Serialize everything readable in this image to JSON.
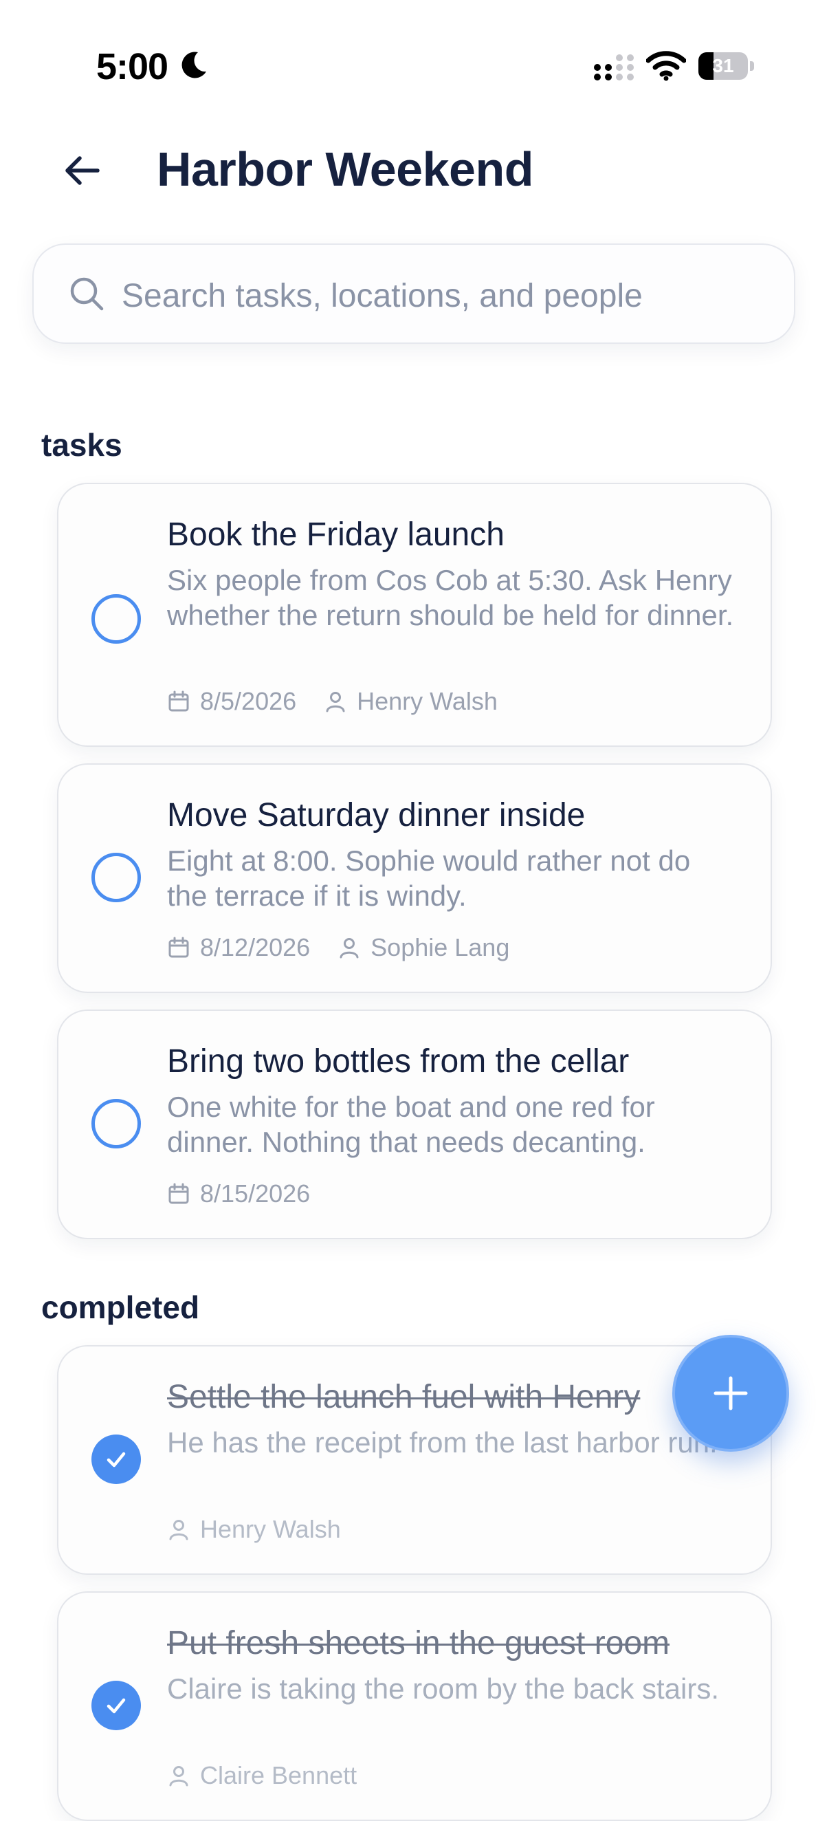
{
  "status_bar": {
    "time": "5:00",
    "battery_level": "31",
    "battery_fraction": 0.31
  },
  "header": {
    "title": "Harbor Weekend"
  },
  "search": {
    "placeholder": "Search tasks, locations, and people",
    "value": ""
  },
  "sections": {
    "tasks": {
      "label": "tasks",
      "items": [
        {
          "title": "Book the Friday launch",
          "description": "Six people from Cos Cob at 5:30. Ask Henry whether the return should be held for dinner.",
          "date": "8/5/2026",
          "person": "Henry Walsh",
          "completed": false
        },
        {
          "title": "Move Saturday dinner inside",
          "description": "Eight at 8:00. Sophie would rather not do the terrace if it is windy.",
          "date": "8/12/2026",
          "person": "Sophie Lang",
          "completed": false
        },
        {
          "title": "Bring two bottles from the cellar",
          "description": "One white for the boat and one red for dinner. Nothing that needs decanting.",
          "date": "8/15/2026",
          "completed": false
        }
      ]
    },
    "completed": {
      "label": "completed",
      "items": [
        {
          "title": "Settle the launch fuel with Henry",
          "description": "He has the receipt from the last harbor run.",
          "person": "Henry Walsh",
          "completed": true
        },
        {
          "title": "Put fresh sheets in the guest room",
          "description": "Claire is taking the room by the back stairs.",
          "person": "Claire Bennett",
          "completed": true
        }
      ]
    }
  },
  "icons": {
    "back": "arrow-left-icon",
    "search": "search-icon",
    "calendar": "calendar-icon",
    "person": "person-icon",
    "check": "check-icon",
    "add": "plus-icon"
  },
  "colors": {
    "accent": "#4a8df0",
    "fab": "#5b9cf5",
    "title_text": "#16213f",
    "muted_text": "#8a93a6"
  }
}
